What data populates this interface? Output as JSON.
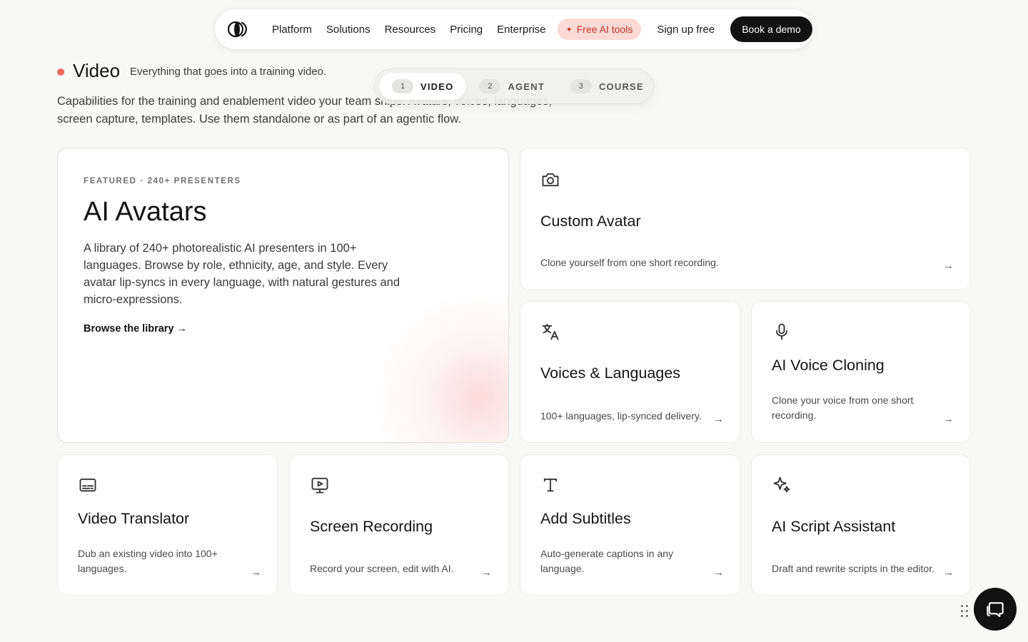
{
  "nav": {
    "links": [
      "Platform",
      "Solutions",
      "Resources",
      "Pricing",
      "Enterprise"
    ],
    "free_tools": "Free AI tools",
    "signup": "Sign up free",
    "demo": "Book a demo"
  },
  "section": {
    "title": "Video",
    "tagline": "Everything that goes into a training video.",
    "description": "Capabilities for the training and enablement video your team ships. Avatars, voices, languages, screen capture, templates. Use them standalone or as part of an agentic flow."
  },
  "steps": [
    {
      "num": "1",
      "label": "VIDEO"
    },
    {
      "num": "2",
      "label": "AGENT"
    },
    {
      "num": "3",
      "label": "COURSE"
    }
  ],
  "featured": {
    "eyebrow": "FEATURED · 240+ PRESENTERS",
    "title": "AI Avatars",
    "description": "A library of 240+ photorealistic AI presenters in 100+ languages. Browse by role, ethnicity, age, and style. Every avatar lip-syncs in every language, with natural gestures and micro-expressions.",
    "link": "Browse the library →"
  },
  "cards": {
    "custom_avatar": {
      "title": "Custom Avatar",
      "desc": "Clone yourself from one short recording.",
      "icon": "camera-icon"
    },
    "voices": {
      "title": "Voices & Languages",
      "desc": "100+ languages, lip-synced delivery.",
      "icon": "translate-icon"
    },
    "voice_cloning": {
      "title": "AI Voice Cloning",
      "desc": "Clone your voice from one short recording.",
      "icon": "microphone-icon"
    },
    "translator": {
      "title": "Video Translator",
      "desc": "Dub an existing video into 100+ languages.",
      "icon": "subtitles-icon"
    },
    "screen_recording": {
      "title": "Screen Recording",
      "desc": "Record your screen, edit with AI.",
      "icon": "monitor-play-icon"
    },
    "subtitles": {
      "title": "Add Subtitles",
      "desc": "Auto-generate captions in any language.",
      "icon": "text-icon"
    },
    "script": {
      "title": "AI Script Assistant",
      "desc": "Draft and rewrite scripts in the editor.",
      "icon": "sparkles-icon"
    }
  },
  "arrow": "→",
  "colors": {
    "accent": "#ec6a5e",
    "free_tools_bg": "#fbd9d5",
    "dark": "#121212"
  }
}
